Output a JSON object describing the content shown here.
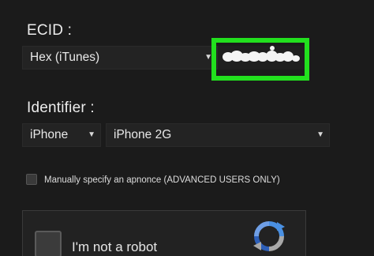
{
  "ecid": {
    "title": "ECID :",
    "format_select": {
      "value": "Hex (iTunes)",
      "caret": "▼"
    },
    "value_redacted": true
  },
  "identifier": {
    "title": "Identifier :",
    "device_type_select": {
      "value": "iPhone",
      "caret": "▼"
    },
    "device_model_select": {
      "value": "iPhone 2G",
      "caret": "▼"
    }
  },
  "apnonce": {
    "checked": false,
    "label": "Manually specify an apnonce (ADVANCED USERS ONLY)"
  },
  "captcha": {
    "label": "I'm not a robot",
    "checked": false,
    "logo_icon": "recaptcha-icon"
  },
  "colors": {
    "highlight": "#22e01e",
    "background": "#1b1b1b"
  }
}
